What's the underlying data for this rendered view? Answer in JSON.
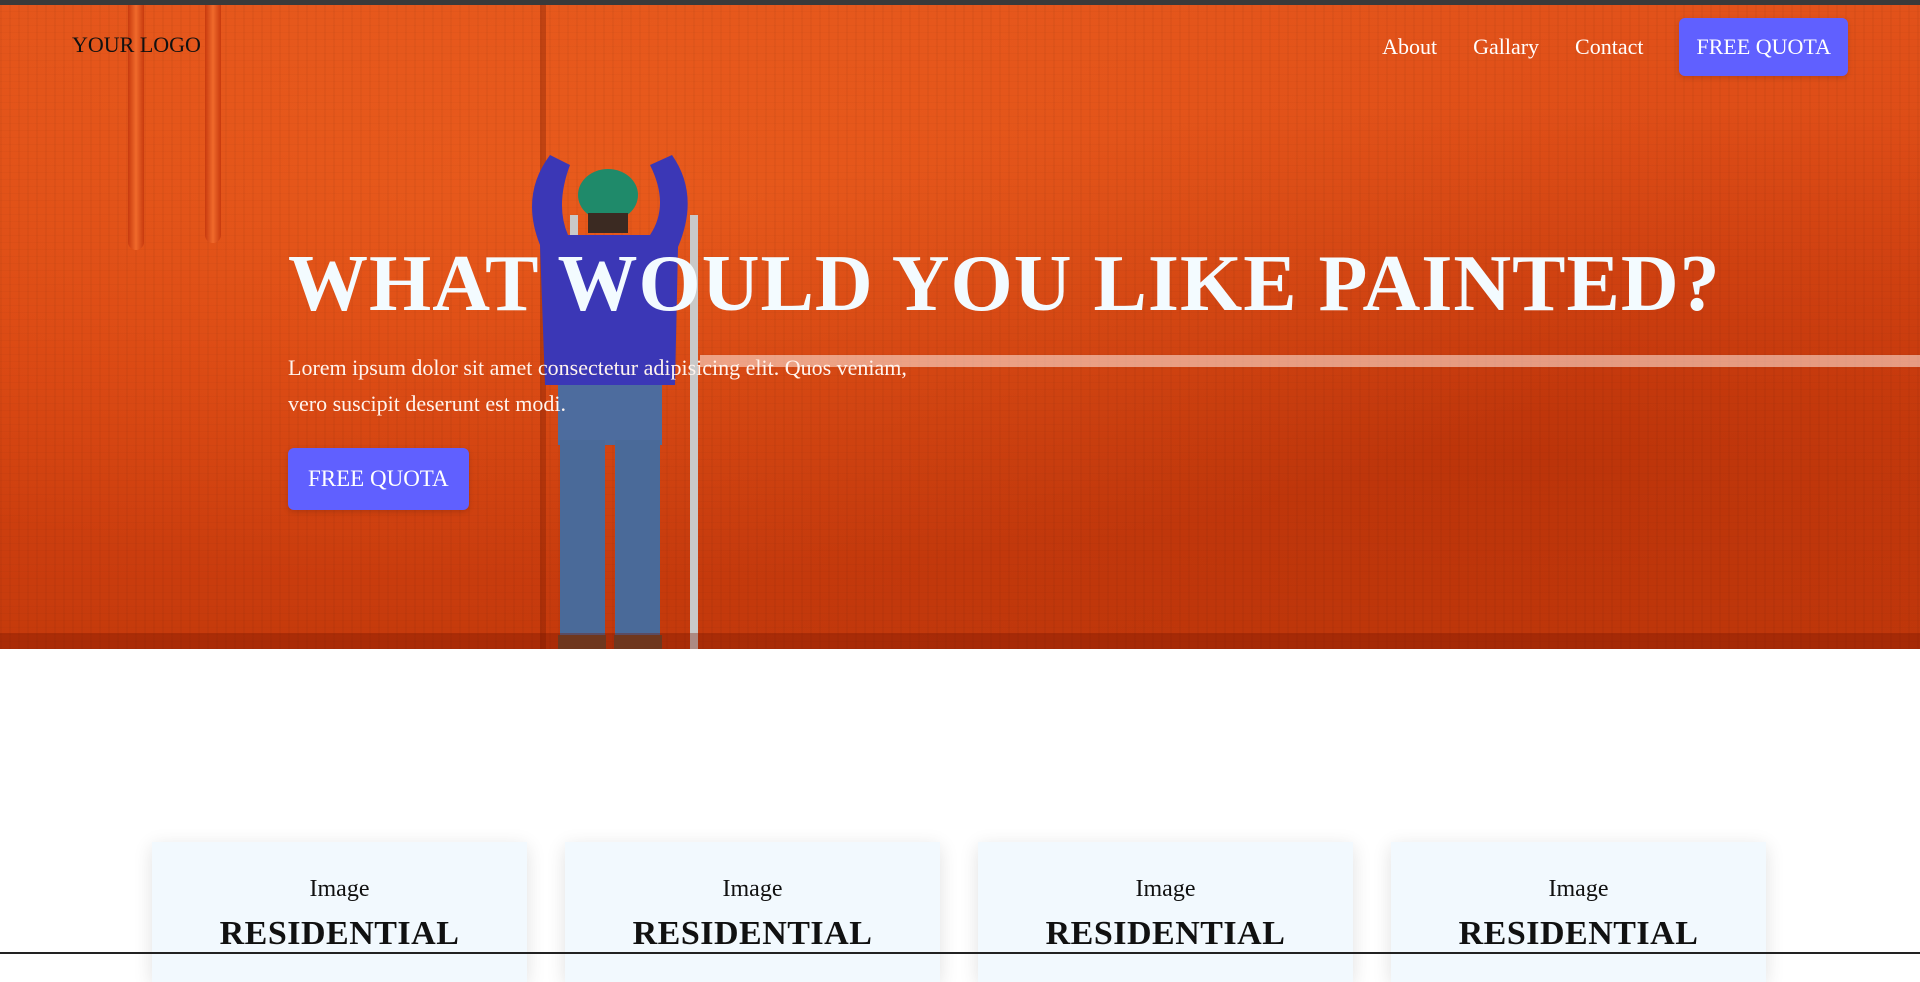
{
  "nav": {
    "logo": "YOUR LOGO",
    "links": [
      "About",
      "Gallary",
      "Contact"
    ],
    "cta": "FREE QUOTA"
  },
  "hero": {
    "title": "WHAT WOULD YOU LIKE PAINTED?",
    "description": "Lorem ipsum dolor sit amet consectetur adipisicing elit. Quos veniam, vero suscipit deserunt est modi.",
    "cta": "FREE QUOTA",
    "background_color": "#d64311"
  },
  "cards": [
    {
      "image": "Image",
      "title": "RESIDENTIAL"
    },
    {
      "image": "Image",
      "title": "RESIDENTIAL"
    },
    {
      "image": "Image",
      "title": "RESIDENTIAL"
    },
    {
      "image": "Image",
      "title": "RESIDENTIAL"
    }
  ],
  "colors": {
    "accent": "#6060ff",
    "card_background": "#f2f9fe"
  }
}
